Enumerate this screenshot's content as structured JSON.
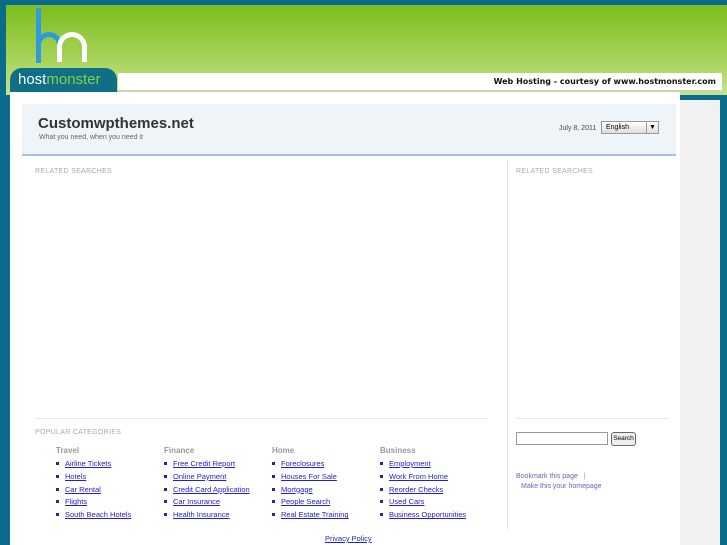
{
  "brand": {
    "host": "host",
    "monster": "monster",
    "tagline": "Web Hosting - courtesy of www.hostmonster.com"
  },
  "header": {
    "title": "Customwpthemes.net",
    "subtitle": "What you need, when you need it",
    "date": "July 8, 2011",
    "language": "English"
  },
  "left": {
    "related_label": "RELATED SEARCHES",
    "popular_label": "POPULAR CATEGORIES"
  },
  "categories": [
    {
      "name": "Travel",
      "items": [
        "Airline Tickets",
        "Hotels",
        "Car Rental",
        "Flights",
        "South Beach Hotels"
      ]
    },
    {
      "name": "Finance",
      "items": [
        "Free Credit Report",
        "Online Payment",
        "Credit Card Application",
        "Car Insurance",
        "Health Insurance"
      ]
    },
    {
      "name": "Home",
      "items": [
        "Foreclosures",
        "Houses For Sale",
        "Mortgage",
        "People Search",
        "Real Estate Training"
      ]
    },
    {
      "name": "Business",
      "items": [
        "Employment",
        "Work From Home",
        "Reorder Checks",
        "Used Cars",
        "Business Opportunities"
      ]
    }
  ],
  "right": {
    "related_label": "RELATED SEARCHES",
    "search_button": "Search",
    "search_value": "",
    "bookmark": "Bookmark this page",
    "separator": "|",
    "homepage": "Make this your homepage"
  },
  "footer": {
    "privacy": "Privacy Policy"
  }
}
